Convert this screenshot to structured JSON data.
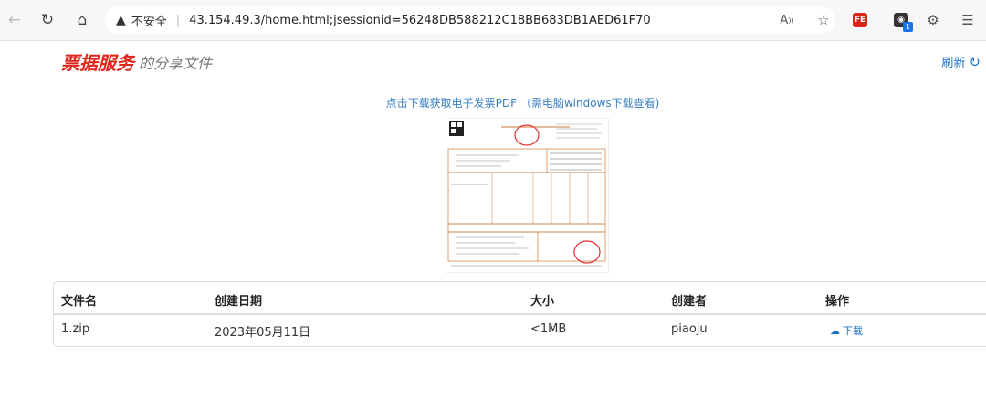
{
  "browser": {
    "security_label": "不安全",
    "url": "43.154.49.3/home.html;jsessionid=56248DB588212C18BB683DB1AED61F70",
    "read_aloud_label": "Aʬ"
  },
  "header": {
    "brand": "票据服务",
    "subtitle": "的分享文件",
    "refresh_label": "刷新"
  },
  "download_link": "点击下载获取电子发票PDF （需电脑windows下载查看)",
  "table": {
    "headers": [
      "文件名",
      "创建日期",
      "大小",
      "创建者",
      "操作"
    ],
    "rows": [
      {
        "name": "1.zip",
        "date": "2023年05月11日",
        "size": "<1MB",
        "creator": "piaoju",
        "action": "下载"
      }
    ]
  },
  "colors": {
    "brand": "#e0261b",
    "link": "#3a7fc1"
  }
}
